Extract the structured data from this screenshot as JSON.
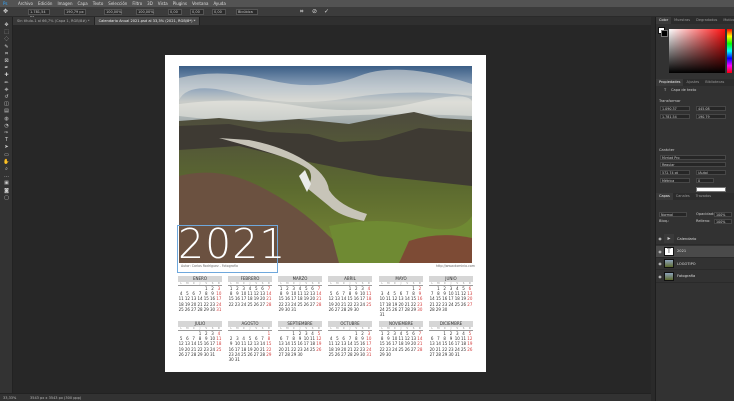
{
  "menu": [
    "Archivo",
    "Edición",
    "Imagen",
    "Capa",
    "Texto",
    "Selección",
    "Filtro",
    "3D",
    "Vista",
    "Plugins",
    "Ventana",
    "Ayuda"
  ],
  "options": {
    "x": "1.781,54 px",
    "y": "190,79 px",
    "w": "100,00%",
    "h": "100,00%",
    "angle": "0,00",
    "hskew": "0,00",
    "vskew": "0,00",
    "interp": "Bicúbica"
  },
  "tabs": [
    {
      "label": "Sin título-1 al 66,7% (Capa 1, RGB/8#) *",
      "active": false
    },
    {
      "label": "Calendario Anual 2021.psd al 33,3% (2021, RGB/8*) *",
      "active": true
    }
  ],
  "tools": [
    "move-icon",
    "marquee-icon",
    "lasso-icon",
    "quick-select-icon",
    "crop-icon",
    "frame-icon",
    "eyedropper-icon",
    "healing-icon",
    "brush-icon",
    "stamp-icon",
    "history-brush-icon",
    "eraser-icon",
    "gradient-icon",
    "blur-icon",
    "dodge-icon",
    "pen-icon",
    "type-icon",
    "path-select-icon",
    "shape-icon",
    "hand-icon",
    "zoom-icon",
    "more-icon",
    "colors-icon",
    "mask-icon",
    "screen-mode-icon"
  ],
  "status": {
    "zoom": "33,33%",
    "doc": "3543 px x 3543 px (300 ppp)"
  },
  "right": {
    "color_tabs": [
      "Color",
      "Muestras",
      "Degradados",
      "Motivos"
    ],
    "prop_tabs": [
      "Propiedades",
      "Ajustes",
      "Bibliotecas"
    ],
    "layer_kind": "Capa de texto",
    "transform_title": "Transformar",
    "t_w": "1.090,37",
    "t_h": "445,08",
    "t_x": "1.781,54",
    "t_y": "190,79",
    "char_title": "Carácter",
    "font": "Myriad Pro",
    "style": "Regular",
    "size": "572,74 pt",
    "leading": "(Auto)",
    "tracking": "0",
    "kerning": "Métrica",
    "layers_tabs": [
      "Capas",
      "Canales",
      "Trazados"
    ],
    "blend": "Normal",
    "opacity_label": "Opacidad:",
    "opacity": "100%",
    "fill_label": "Relleno:",
    "fill": "100%",
    "lock_label": "Bloq.:",
    "layers": [
      {
        "name": "Calendario",
        "selected": false,
        "kind": "folder"
      },
      {
        "name": "2021",
        "selected": true,
        "kind": "text"
      },
      {
        "name": "LOGOTIPO",
        "selected": false,
        "kind": "image"
      },
      {
        "name": "Fotografía",
        "selected": false,
        "kind": "image"
      }
    ]
  },
  "document": {
    "year": "2021",
    "credit_left": "Autor: Carlos Rodríguez - Fotografía",
    "credit_right": "http://www.dominio.com",
    "weekdays": [
      "L",
      "M",
      "X",
      "J",
      "V",
      "S",
      "D"
    ],
    "months": [
      {
        "name": "ENERO",
        "days": [
          "",
          "",
          "",
          "",
          "1",
          "2",
          "3",
          "4",
          "5",
          "6",
          "7",
          "8",
          "9",
          "10",
          "11",
          "12",
          "13",
          "14",
          "15",
          "16",
          "17",
          "18",
          "19",
          "20",
          "21",
          "22",
          "23",
          "24",
          "25",
          "26",
          "27",
          "28",
          "29",
          "30",
          "31"
        ]
      },
      {
        "name": "FEBRERO",
        "days": [
          "1",
          "2",
          "3",
          "4",
          "5",
          "6",
          "7",
          "8",
          "9",
          "10",
          "11",
          "12",
          "13",
          "14",
          "15",
          "16",
          "17",
          "18",
          "19",
          "20",
          "21",
          "22",
          "23",
          "24",
          "25",
          "26",
          "27",
          "28"
        ]
      },
      {
        "name": "MARZO",
        "days": [
          "1",
          "2",
          "3",
          "4",
          "5",
          "6",
          "7",
          "8",
          "9",
          "10",
          "11",
          "12",
          "13",
          "14",
          "15",
          "16",
          "17",
          "18",
          "19",
          "20",
          "21",
          "22",
          "23",
          "24",
          "25",
          "26",
          "27",
          "28",
          "29",
          "30",
          "31"
        ]
      },
      {
        "name": "ABRIL",
        "days": [
          "",
          "",
          "",
          "1",
          "2",
          "3",
          "4",
          "5",
          "6",
          "7",
          "8",
          "9",
          "10",
          "11",
          "12",
          "13",
          "14",
          "15",
          "16",
          "17",
          "18",
          "19",
          "20",
          "21",
          "22",
          "23",
          "24",
          "25",
          "26",
          "27",
          "28",
          "29",
          "30"
        ]
      },
      {
        "name": "MAYO",
        "days": [
          "",
          "",
          "",
          "",
          "",
          "1",
          "2",
          "3",
          "4",
          "5",
          "6",
          "7",
          "8",
          "9",
          "10",
          "11",
          "12",
          "13",
          "14",
          "15",
          "16",
          "17",
          "18",
          "19",
          "20",
          "21",
          "22",
          "23",
          "24",
          "25",
          "26",
          "27",
          "28",
          "29",
          "30",
          "31"
        ]
      },
      {
        "name": "JUNIO",
        "days": [
          "",
          "1",
          "2",
          "3",
          "4",
          "5",
          "6",
          "7",
          "8",
          "9",
          "10",
          "11",
          "12",
          "13",
          "14",
          "15",
          "16",
          "17",
          "18",
          "19",
          "20",
          "21",
          "22",
          "23",
          "24",
          "25",
          "26",
          "27",
          "28",
          "29",
          "30"
        ]
      },
      {
        "name": "JULIO",
        "days": [
          "",
          "",
          "",
          "1",
          "2",
          "3",
          "4",
          "5",
          "6",
          "7",
          "8",
          "9",
          "10",
          "11",
          "12",
          "13",
          "14",
          "15",
          "16",
          "17",
          "18",
          "19",
          "20",
          "21",
          "22",
          "23",
          "24",
          "25",
          "26",
          "27",
          "28",
          "29",
          "30",
          "31"
        ]
      },
      {
        "name": "AGOSTO",
        "days": [
          "",
          "",
          "",
          "",
          "",
          "",
          "1",
          "2",
          "3",
          "4",
          "5",
          "6",
          "7",
          "8",
          "9",
          "10",
          "11",
          "12",
          "13",
          "14",
          "15",
          "16",
          "17",
          "18",
          "19",
          "20",
          "21",
          "22",
          "23",
          "24",
          "25",
          "26",
          "27",
          "28",
          "29",
          "30",
          "31"
        ]
      },
      {
        "name": "SEPTIEMBRE",
        "days": [
          "",
          "",
          "1",
          "2",
          "3",
          "4",
          "5",
          "6",
          "7",
          "8",
          "9",
          "10",
          "11",
          "12",
          "13",
          "14",
          "15",
          "16",
          "17",
          "18",
          "19",
          "20",
          "21",
          "22",
          "23",
          "24",
          "25",
          "26",
          "27",
          "28",
          "29",
          "30"
        ]
      },
      {
        "name": "OCTUBRE",
        "days": [
          "",
          "",
          "",
          "",
          "1",
          "2",
          "3",
          "4",
          "5",
          "6",
          "7",
          "8",
          "9",
          "10",
          "11",
          "12",
          "13",
          "14",
          "15",
          "16",
          "17",
          "18",
          "19",
          "20",
          "21",
          "22",
          "23",
          "24",
          "25",
          "26",
          "27",
          "28",
          "29",
          "30",
          "31"
        ]
      },
      {
        "name": "NOVIEMBRE",
        "days": [
          "1",
          "2",
          "3",
          "4",
          "5",
          "6",
          "7",
          "8",
          "9",
          "10",
          "11",
          "12",
          "13",
          "14",
          "15",
          "16",
          "17",
          "18",
          "19",
          "20",
          "21",
          "22",
          "23",
          "24",
          "25",
          "26",
          "27",
          "28",
          "29",
          "30"
        ]
      },
      {
        "name": "DICIEMBRE",
        "days": [
          "",
          "",
          "1",
          "2",
          "3",
          "4",
          "5",
          "6",
          "7",
          "8",
          "9",
          "10",
          "11",
          "12",
          "13",
          "14",
          "15",
          "16",
          "17",
          "18",
          "19",
          "20",
          "21",
          "22",
          "23",
          "24",
          "25",
          "26",
          "27",
          "28",
          "29",
          "30",
          "31"
        ]
      }
    ]
  },
  "colors": {
    "app_bg": "#282828",
    "panel": "#323232",
    "accent_red": "#d23c3c",
    "selection": "#6fa8dc",
    "fg_swatch": "#ffffff",
    "bg_swatch": "#000000"
  }
}
